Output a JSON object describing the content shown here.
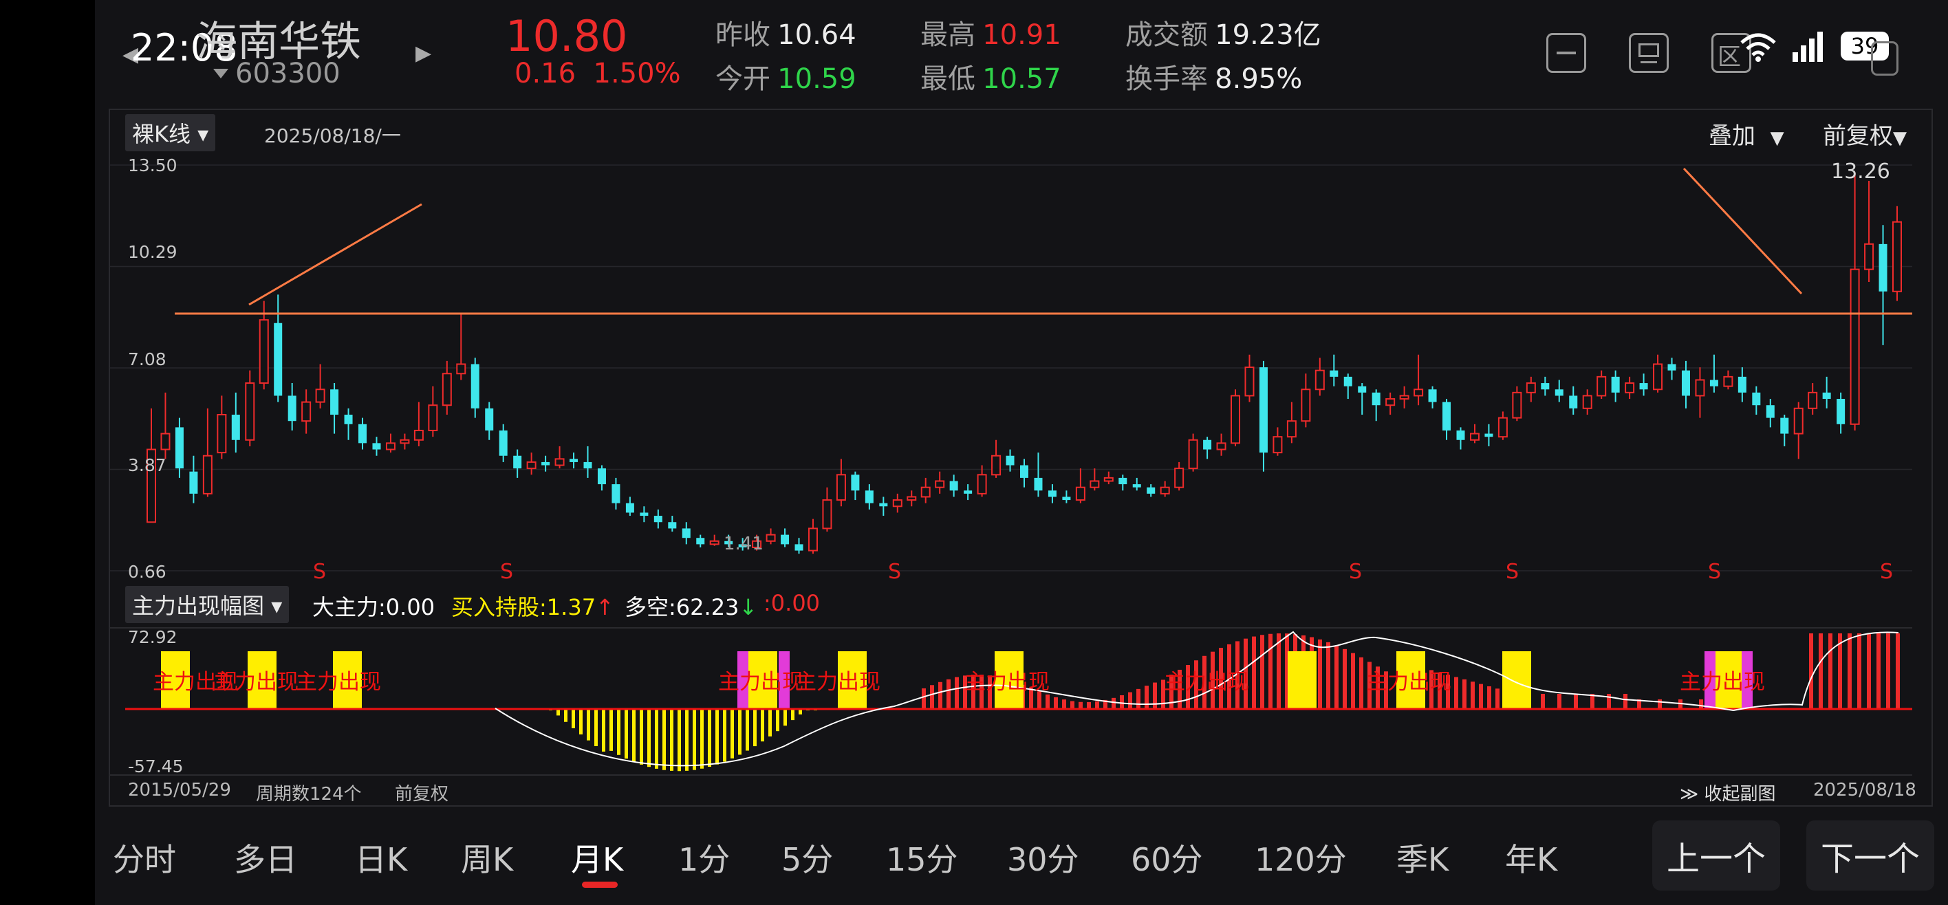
{
  "header": {
    "time": "22:08",
    "stock_name": "海南华铁",
    "stock_code": "603300",
    "price": "10.80",
    "change": "0.16",
    "change_pct": "1.50%",
    "prev_close_label": "昨收",
    "prev_close": "10.64",
    "open_label": "今开",
    "open": "10.59",
    "high_label": "最高",
    "high": "10.91",
    "low_label": "最低",
    "low": "10.57",
    "turnover_label": "成交额",
    "turnover": "19.23亿",
    "turnover_rate_label": "换手率",
    "turnover_rate": "8.95%",
    "battery": "39",
    "icons": [
      "minimize-icon",
      "screen-icon",
      "zone-icon",
      "wifi-icon",
      "signal-icon",
      "battery-icon"
    ]
  },
  "chart": {
    "kline_type": "裸K线",
    "date": "2025/08/18/一",
    "overlay": "叠加",
    "adjust": "前复权",
    "y_ticks": [
      "13.50",
      "10.29",
      "7.08",
      "3.87",
      "0.66"
    ],
    "high_marker": "13.26",
    "low_marker": "1.41",
    "s_marker": "S"
  },
  "indicator": {
    "name": "主力出现幅图",
    "big_main_label": "大主力:",
    "big_main": "0.00",
    "buy_hold_label": "买入持股:",
    "buy_hold": "1.37",
    "bull_bear_label": "多空:",
    "bull_bear": "62.23",
    "extra": ":0.00",
    "y_top": "72.92",
    "y_bottom": "-57.45",
    "event_label": "主力出现",
    "start_date": "2015/05/29",
    "period_count": "周期数124个",
    "adjust": "前复权",
    "collapse": "收起副图",
    "end_date": "2025/08/18"
  },
  "tabs": [
    "分时",
    "多日",
    "日K",
    "周K",
    "月K",
    "1分",
    "5分",
    "15分",
    "30分",
    "60分",
    "120分",
    "季K",
    "年K"
  ],
  "active_tab": "月K",
  "nav": {
    "prev": "上一个",
    "next": "下一个"
  },
  "colors": {
    "up": "#ee2b2b",
    "down": "#3fe6ec",
    "trend_line": "#ff7b45",
    "yellow": "#ffee00",
    "magenta": "#e23bd8"
  },
  "chart_data": {
    "type": "candlestick",
    "timeframe": "monthly",
    "period_count": 124,
    "x_range": [
      "2015/05/29",
      "2025/08/18"
    ],
    "ylim": [
      0.66,
      13.5
    ],
    "y_ticks": [
      13.5,
      10.29,
      7.08,
      3.87,
      0.66
    ],
    "annotations": {
      "high": 13.26,
      "low": 1.41,
      "horizontal_line": 8.8
    },
    "candles": [
      [
        2.2,
        4.5,
        5.8,
        2.2
      ],
      [
        4.5,
        5.0,
        6.3,
        4.2
      ],
      [
        5.2,
        3.9,
        5.5,
        3.6
      ],
      [
        3.8,
        3.1,
        4.3,
        2.8
      ],
      [
        3.1,
        4.3,
        5.8,
        3.0
      ],
      [
        4.4,
        5.6,
        6.2,
        4.2
      ],
      [
        5.6,
        4.8,
        6.3,
        4.4
      ],
      [
        4.8,
        6.6,
        7.0,
        4.6
      ],
      [
        6.6,
        8.6,
        9.2,
        6.4
      ],
      [
        8.5,
        6.2,
        9.4,
        6.0
      ],
      [
        6.2,
        5.4,
        6.6,
        5.1
      ],
      [
        5.4,
        6.0,
        6.4,
        5.0
      ],
      [
        6.0,
        6.4,
        7.2,
        5.8
      ],
      [
        6.4,
        5.6,
        6.6,
        5.0
      ],
      [
        5.6,
        5.3,
        5.8,
        4.8
      ],
      [
        5.3,
        4.7,
        5.5,
        4.5
      ],
      [
        4.7,
        4.5,
        4.9,
        4.3
      ],
      [
        4.5,
        4.7,
        5.0,
        4.4
      ],
      [
        4.7,
        4.8,
        5.0,
        4.5
      ],
      [
        4.8,
        5.1,
        6.0,
        4.6
      ],
      [
        5.1,
        5.9,
        6.5,
        4.9
      ],
      [
        5.9,
        6.9,
        7.3,
        5.6
      ],
      [
        6.9,
        7.2,
        8.8,
        6.7
      ],
      [
        7.2,
        5.8,
        7.4,
        5.5
      ],
      [
        5.8,
        5.1,
        6.0,
        4.8
      ],
      [
        5.1,
        4.3,
        5.3,
        4.1
      ],
      [
        4.3,
        3.9,
        4.5,
        3.6
      ],
      [
        3.9,
        4.1,
        4.4,
        3.7
      ],
      [
        4.1,
        4.0,
        4.3,
        3.8
      ],
      [
        4.0,
        4.2,
        4.6,
        3.9
      ],
      [
        4.2,
        4.1,
        4.4,
        3.9
      ],
      [
        4.1,
        3.9,
        4.6,
        3.6
      ],
      [
        3.9,
        3.4,
        4.0,
        3.2
      ],
      [
        3.4,
        2.8,
        3.6,
        2.6
      ],
      [
        2.8,
        2.5,
        3.0,
        2.4
      ],
      [
        2.5,
        2.4,
        2.7,
        2.2
      ],
      [
        2.4,
        2.2,
        2.6,
        2.0
      ],
      [
        2.2,
        2.0,
        2.4,
        1.9
      ],
      [
        2.0,
        1.7,
        2.2,
        1.5
      ],
      [
        1.7,
        1.5,
        1.8,
        1.4
      ],
      [
        1.5,
        1.6,
        1.8,
        1.45
      ],
      [
        1.6,
        1.5,
        1.8,
        1.41
      ],
      [
        1.5,
        1.4,
        1.7,
        1.3
      ],
      [
        1.4,
        1.6,
        1.8,
        1.3
      ],
      [
        1.6,
        1.8,
        2.0,
        1.5
      ],
      [
        1.8,
        1.5,
        2.0,
        1.41
      ],
      [
        1.5,
        1.3,
        1.7,
        1.2
      ],
      [
        1.3,
        2.0,
        2.3,
        1.2
      ],
      [
        2.0,
        2.9,
        3.3,
        1.9
      ],
      [
        2.9,
        3.7,
        4.2,
        2.7
      ],
      [
        3.7,
        3.2,
        3.8,
        2.9
      ],
      [
        3.2,
        2.8,
        3.4,
        2.6
      ],
      [
        2.8,
        2.7,
        3.0,
        2.4
      ],
      [
        2.7,
        2.9,
        3.1,
        2.5
      ],
      [
        2.9,
        3.0,
        3.2,
        2.7
      ],
      [
        3.0,
        3.3,
        3.6,
        2.8
      ],
      [
        3.3,
        3.5,
        3.8,
        3.1
      ],
      [
        3.5,
        3.2,
        3.7,
        3.0
      ],
      [
        3.2,
        3.1,
        3.4,
        2.9
      ],
      [
        3.1,
        3.7,
        4.0,
        3.0
      ],
      [
        3.7,
        4.3,
        4.8,
        3.6
      ],
      [
        4.3,
        4.0,
        4.5,
        3.8
      ],
      [
        4.0,
        3.6,
        4.2,
        3.3
      ],
      [
        3.6,
        3.2,
        4.4,
        3.0
      ],
      [
        3.2,
        3.0,
        3.4,
        2.8
      ],
      [
        3.0,
        2.9,
        3.2,
        2.8
      ],
      [
        2.9,
        3.3,
        3.9,
        2.8
      ],
      [
        3.3,
        3.5,
        3.9,
        3.2
      ],
      [
        3.5,
        3.6,
        3.8,
        3.4
      ],
      [
        3.6,
        3.4,
        3.7,
        3.2
      ],
      [
        3.4,
        3.3,
        3.6,
        3.2
      ],
      [
        3.3,
        3.1,
        3.4,
        3.0
      ],
      [
        3.1,
        3.3,
        3.5,
        3.0
      ],
      [
        3.3,
        3.9,
        4.1,
        3.2
      ],
      [
        3.9,
        4.8,
        5.0,
        3.8
      ],
      [
        4.8,
        4.5,
        4.9,
        4.2
      ],
      [
        4.5,
        4.7,
        5.0,
        4.3
      ],
      [
        4.7,
        6.2,
        6.4,
        4.6
      ],
      [
        6.2,
        7.1,
        7.5,
        6.0
      ],
      [
        7.1,
        4.4,
        7.3,
        3.8
      ],
      [
        4.4,
        4.9,
        5.2,
        4.3
      ],
      [
        4.9,
        5.4,
        6.0,
        4.7
      ],
      [
        5.4,
        6.4,
        6.9,
        5.2
      ],
      [
        6.4,
        7.0,
        7.4,
        6.2
      ],
      [
        7.0,
        6.8,
        7.5,
        6.5
      ],
      [
        6.8,
        6.5,
        6.9,
        6.1
      ],
      [
        6.5,
        6.3,
        6.6,
        5.6
      ],
      [
        6.3,
        5.9,
        6.4,
        5.4
      ],
      [
        5.9,
        6.1,
        6.3,
        5.6
      ],
      [
        6.1,
        6.2,
        6.5,
        5.8
      ],
      [
        6.2,
        6.4,
        7.5,
        5.9
      ],
      [
        6.4,
        6.0,
        6.5,
        5.8
      ],
      [
        6.0,
        5.1,
        6.1,
        4.8
      ],
      [
        5.1,
        4.8,
        5.2,
        4.5
      ],
      [
        4.8,
        5.0,
        5.3,
        4.7
      ],
      [
        5.0,
        4.9,
        5.3,
        4.6
      ],
      [
        4.9,
        5.5,
        5.7,
        4.8
      ],
      [
        5.5,
        6.3,
        6.5,
        5.4
      ],
      [
        6.3,
        6.6,
        6.8,
        6.0
      ],
      [
        6.6,
        6.4,
        6.8,
        6.2
      ],
      [
        6.4,
        6.2,
        6.7,
        6.0
      ],
      [
        6.2,
        5.8,
        6.5,
        5.6
      ],
      [
        5.8,
        6.2,
        6.4,
        5.6
      ],
      [
        6.2,
        6.8,
        7.0,
        6.1
      ],
      [
        6.8,
        6.3,
        7.0,
        6.0
      ],
      [
        6.3,
        6.6,
        6.8,
        6.1
      ],
      [
        6.6,
        6.4,
        6.9,
        6.2
      ],
      [
        6.4,
        7.2,
        7.5,
        6.3
      ],
      [
        7.2,
        7.0,
        7.4,
        6.7
      ],
      [
        7.0,
        6.2,
        7.3,
        5.8
      ],
      [
        6.2,
        6.7,
        7.1,
        5.5
      ],
      [
        6.7,
        6.5,
        7.5,
        6.3
      ],
      [
        6.5,
        6.8,
        7.0,
        6.4
      ],
      [
        6.8,
        6.3,
        7.1,
        6.0
      ],
      [
        6.3,
        5.9,
        6.5,
        5.6
      ],
      [
        5.9,
        5.5,
        6.1,
        5.2
      ],
      [
        5.5,
        5.0,
        5.6,
        4.6
      ],
      [
        5.0,
        5.8,
        6.0,
        4.2
      ],
      [
        5.8,
        6.3,
        6.6,
        5.6
      ],
      [
        6.3,
        6.1,
        6.8,
        5.8
      ],
      [
        6.1,
        5.3,
        6.3,
        5.0
      ],
      [
        5.3,
        10.2,
        13.26,
        5.1
      ],
      [
        10.2,
        11.0,
        13.0,
        9.8
      ],
      [
        11.0,
        9.5,
        11.6,
        7.8
      ],
      [
        9.5,
        11.7,
        12.2,
        9.2
      ]
    ],
    "candle_fields": [
      "open",
      "close",
      "high",
      "low"
    ],
    "indicator_range": [
      -57.45,
      72.92
    ]
  }
}
